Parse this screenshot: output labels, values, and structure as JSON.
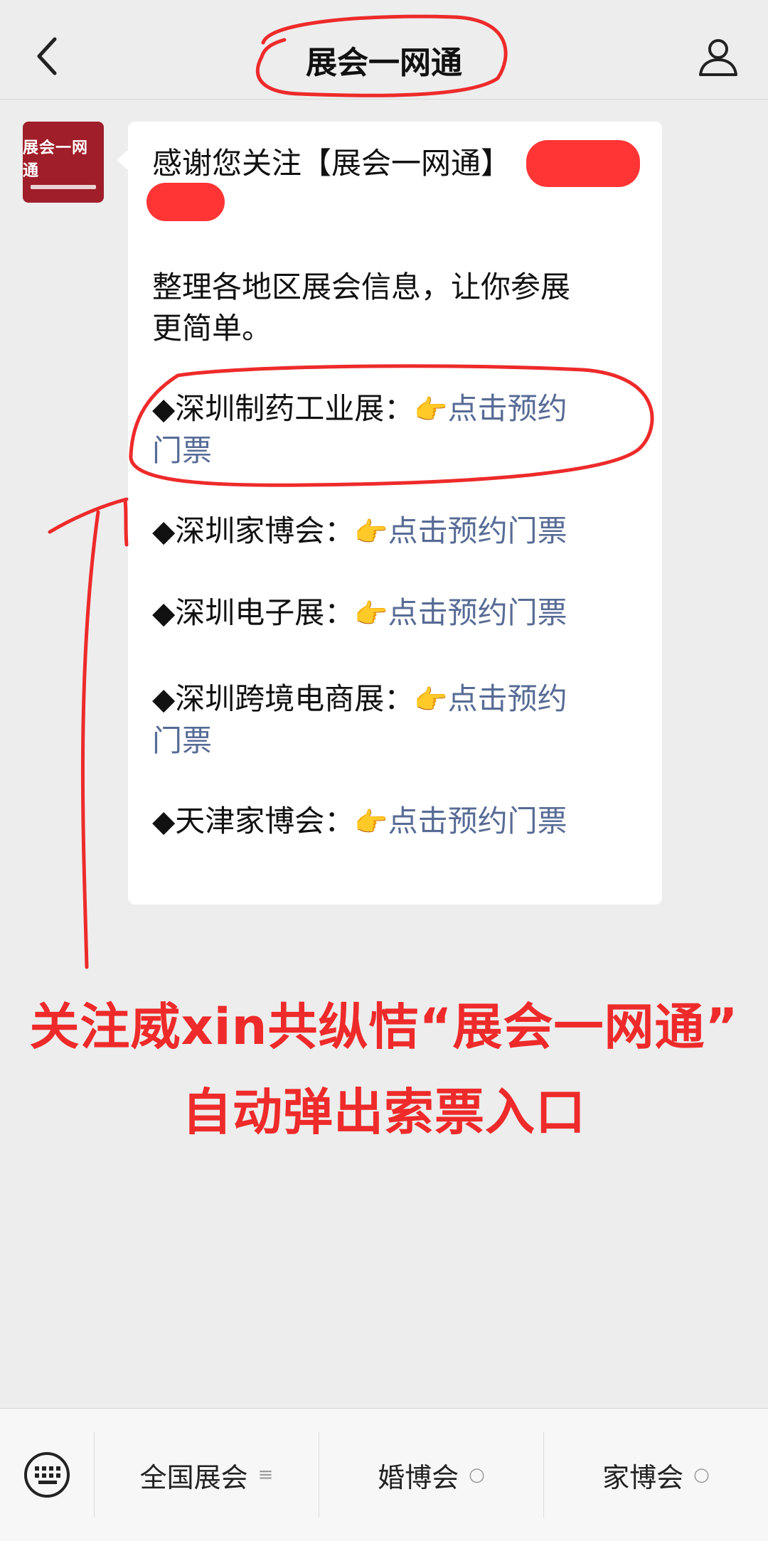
{
  "header": {
    "title": "展会一网通",
    "back_icon": "chevron-left-icon",
    "profile_icon": "person-icon"
  },
  "avatar": {
    "text": "展会一网通"
  },
  "message": {
    "intro": "感谢您关注【展会一网通】",
    "line2": "整理各地区展会信息，让你参展",
    "line3": "更简单。",
    "items": [
      {
        "prefix": "◆深圳制药工业展：",
        "link": "点击预约",
        "link_wrap": "门票"
      },
      {
        "prefix": "◆深圳家博会：",
        "link": "点击预约门票"
      },
      {
        "prefix": "◆深圳电子展：",
        "link": "点击预约门票"
      },
      {
        "prefix": "◆深圳跨境电商展：",
        "link": "点击预约",
        "link_wrap": "门票"
      },
      {
        "prefix": "◆天津家博会：",
        "link": "点击预约门票"
      }
    ],
    "emoji": "👉"
  },
  "overlay": {
    "line1": "关注威xin共纵恄“展会一网通”",
    "line2": "自动弹出索票入口"
  },
  "bottom_menu": {
    "items": [
      {
        "label": "全国展会",
        "icon": "≡"
      },
      {
        "label": "婚博会",
        "icon": "○"
      },
      {
        "label": "家博会",
        "icon": "○"
      }
    ]
  },
  "colors": {
    "link": "#576b95",
    "annotation": "#ee2a2a",
    "avatar_bg": "#a01e2a"
  }
}
